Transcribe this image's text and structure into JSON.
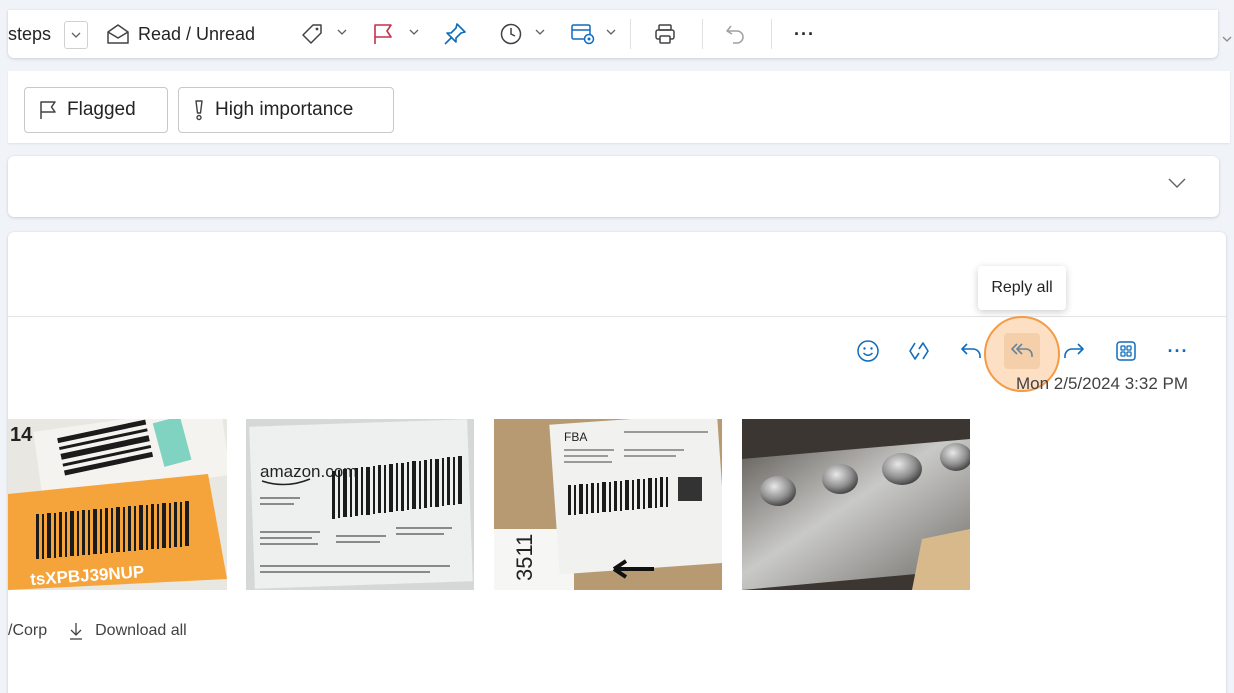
{
  "toolbar": {
    "rules_label": "steps",
    "read_unread_label": "Read / Unread",
    "more_label": "···"
  },
  "filters": {
    "flagged_label": "Flagged",
    "high_importance_label": "High importance"
  },
  "message": {
    "tooltip": "Reply all",
    "timestamp": "Mon 2/5/2024 3:32 PM",
    "more_label": "···",
    "attachment_partial_label": "/Corp",
    "download_all_label": "Download all",
    "attachments": [
      {
        "icon": "barcode-label-photo"
      },
      {
        "icon": "amazon-shipping-label-photo",
        "label": "amazon.com"
      },
      {
        "icon": "fba-shipping-label-photo",
        "label": "FBA"
      },
      {
        "icon": "metal-knobs-photo"
      }
    ]
  },
  "colors": {
    "accent_blue": "#0f6cbd",
    "flag_red": "#c4314b",
    "highlight_orange": "#f59a45"
  }
}
